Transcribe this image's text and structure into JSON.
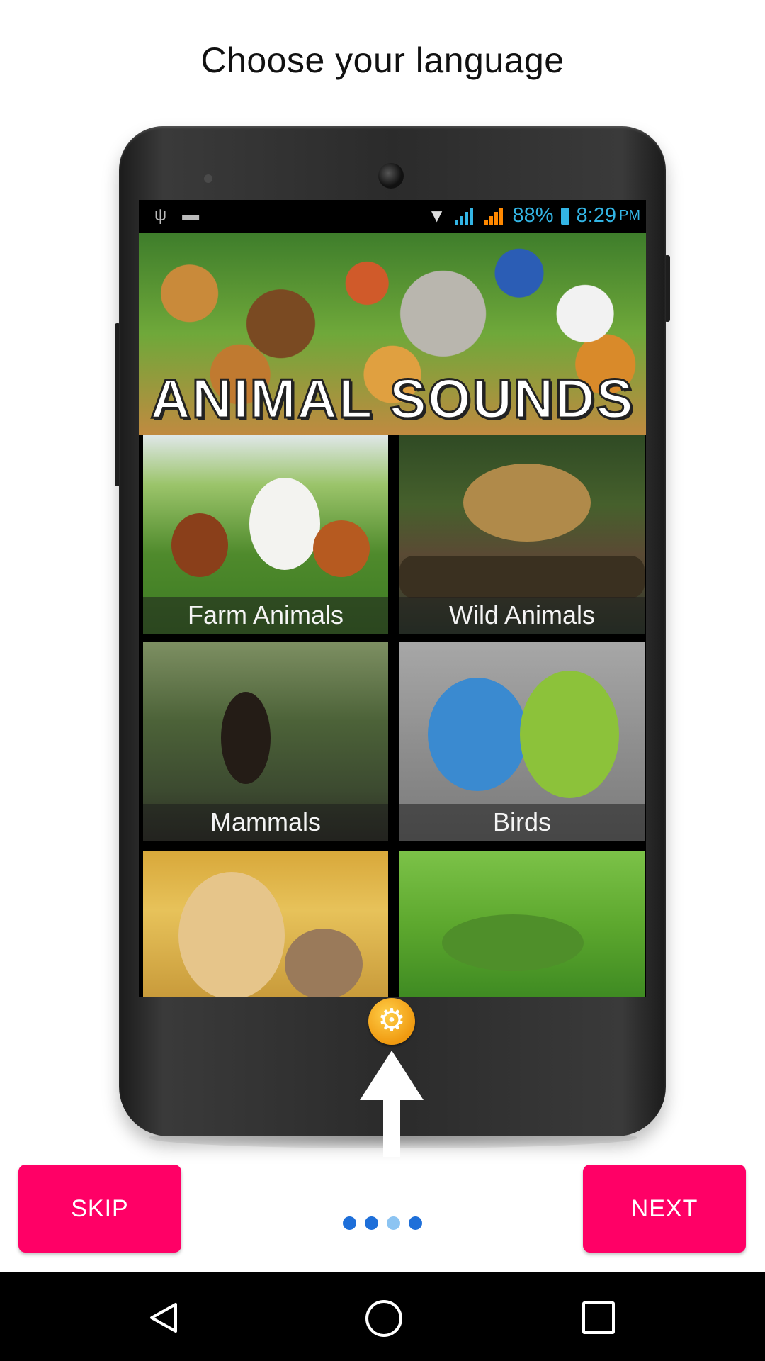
{
  "page": {
    "title": "Choose your language"
  },
  "phone_screen": {
    "status_bar": {
      "battery": "88%",
      "time": "8:29",
      "ampm": "PM"
    },
    "banner_title": "ANIMAL SOUNDS",
    "tiles": [
      {
        "label": "Farm Animals"
      },
      {
        "label": "Wild Animals"
      },
      {
        "label": "Mammals"
      },
      {
        "label": "Birds"
      },
      {
        "label": ""
      },
      {
        "label": ""
      }
    ],
    "settings_icon": "gear-icon"
  },
  "actions": {
    "skip_label": "SKIP",
    "next_label": "NEXT"
  },
  "pager": {
    "count": 4,
    "active_index": 2
  },
  "navbar": {
    "icons": [
      "back-icon",
      "home-icon",
      "recents-icon"
    ]
  },
  "colors": {
    "accent": "#ff0066",
    "dot": "#1e6fd9",
    "dot_active": "#8cc4f2",
    "status_text": "#33b5e5"
  }
}
